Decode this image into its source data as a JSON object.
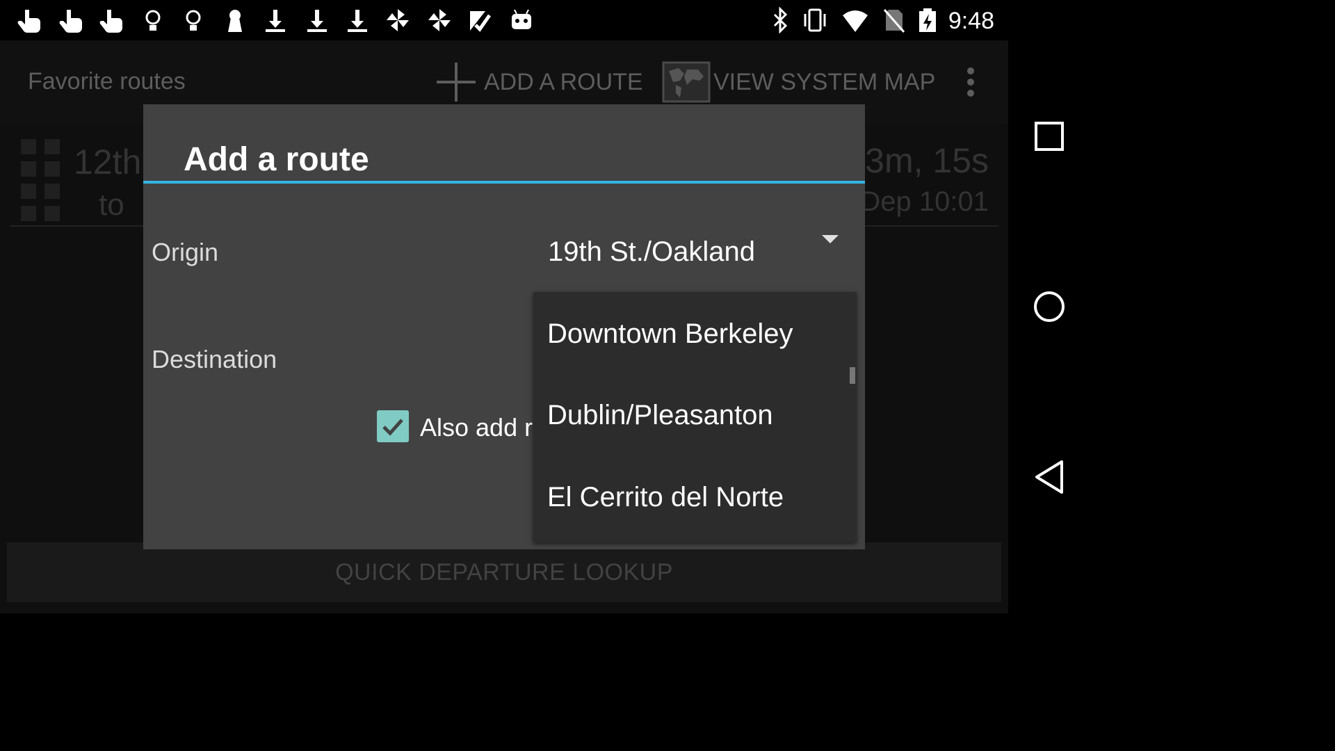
{
  "status_bar": {
    "time": "9:48",
    "left_icons": [
      "hand-pointer-icon",
      "hand-pointer-icon",
      "hand-pointer-icon",
      "lightbulb-icon",
      "lightbulb-icon",
      "keyhole-icon",
      "download-icon",
      "download-icon",
      "download-icon",
      "pinwheel-icon",
      "pinwheel-icon",
      "checklist-icon",
      "android-icon"
    ],
    "right_icons": [
      "bluetooth-icon",
      "vibrate-icon",
      "wifi-icon",
      "no-sim-icon",
      "battery-charging-icon"
    ]
  },
  "action_bar": {
    "title": "Favorite routes",
    "add_route_label": "ADD A ROUTE",
    "view_map_label": "VIEW SYSTEM MAP"
  },
  "background_route": {
    "origin_partial": "12th",
    "to_label": "to",
    "countdown": "3m, 15s",
    "departure": "Dep 10:01"
  },
  "quick_lookup_label": "QUICK DEPARTURE LOOKUP",
  "dialog": {
    "title": "Add a route",
    "origin_label": "Origin",
    "origin_value": "19th St./Oakland",
    "destination_label": "Destination",
    "checkbox_label": "Also add re",
    "checkbox_checked": true,
    "accent_color": "#33b5e5",
    "checkbox_color": "#80cbc4",
    "dropdown_items": [
      "Downtown Berkeley",
      "Dublin/Pleasanton",
      "El Cerrito del Norte"
    ]
  },
  "nav_bar": {
    "buttons": [
      "recents-square-icon",
      "home-circle-icon",
      "back-triangle-icon"
    ]
  }
}
